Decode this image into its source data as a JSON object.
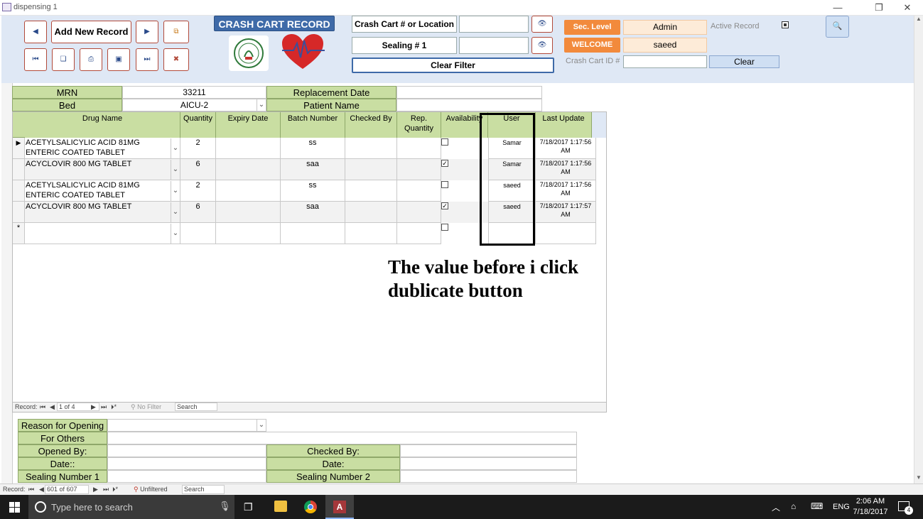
{
  "window": {
    "title": "dispensing 1"
  },
  "header": {
    "add_new_record": "Add New Record",
    "form_title": "CRASH CART RECORD",
    "crash_cart_label": "Crash Cart # or Location",
    "sealing_label": "Sealing  # 1",
    "clear_filter": "Clear Filter",
    "sec_level_label": "Sec. Level",
    "sec_level_value": "Admin",
    "welcome_label": "WELCOME",
    "welcome_value": "saeed",
    "active_record_label": "Active Record",
    "crash_cart_id_label": "Crash Cart ID #",
    "clear_button": "Clear"
  },
  "patient": {
    "mrn_label": "MRN",
    "mrn_value": "33211",
    "bed_label": "Bed",
    "bed_value": "AICU-2",
    "replacement_date_label": "Replacement Date",
    "patient_name_label": "Patient Name"
  },
  "grid": {
    "columns": [
      "Drug Name",
      "Quantity",
      "Expiry Date",
      "Batch Number",
      "Checked By",
      "Rep. Quantity",
      "Availability",
      "User",
      "Last Update"
    ],
    "rows": [
      {
        "drug": "ACETYLSALICYLIC ACID 81MG ENTERIC COATED TABLET",
        "qty": "2",
        "expiry": "",
        "batch": "ss",
        "checked_by": "",
        "rep_qty": "",
        "available": false,
        "user": "Samar",
        "last_update": "7/18/2017 1:17:56 AM"
      },
      {
        "drug": "ACYCLOVIR 800 MG TABLET",
        "qty": "6",
        "expiry": "",
        "batch": "saa",
        "checked_by": "",
        "rep_qty": "",
        "available": true,
        "user": "Samar",
        "last_update": "7/18/2017 1:17:56 AM"
      },
      {
        "drug": "ACETYLSALICYLIC ACID 81MG ENTERIC COATED TABLET",
        "qty": "2",
        "expiry": "",
        "batch": "ss",
        "checked_by": "",
        "rep_qty": "",
        "available": false,
        "user": "saeed",
        "last_update": "7/18/2017 1:17:56 AM"
      },
      {
        "drug": "ACYCLOVIR 800 MG TABLET",
        "qty": "6",
        "expiry": "",
        "batch": "saa",
        "checked_by": "",
        "rep_qty": "",
        "available": true,
        "user": "saeed",
        "last_update": "7/18/2017 1:17:57 AM"
      }
    ],
    "new_row_marker": "*",
    "current_row_marker": "▶"
  },
  "annotation": {
    "line1": "The value before i click",
    "line2": "dublicate button"
  },
  "subform_nav": {
    "label": "Record:",
    "position": "1 of 4",
    "filter": "No Filter",
    "search": "Search"
  },
  "lower": {
    "reason_label": "Reason for Opening",
    "for_others_label": "For Others",
    "opened_by_label": "Opened By:",
    "checked_by_label": "Checked By:",
    "date1_label": "Date::",
    "date2_label": "Date:",
    "sealing1_label": "Sealing Number 1",
    "sealing2_label": "Sealing Number 2"
  },
  "main_nav": {
    "label": "Record:",
    "position": "601 of 607",
    "filter": "Unfiltered",
    "search": "Search"
  },
  "taskbar": {
    "search_placeholder": "Type here to search",
    "lang": "ENG",
    "time": "2:06 AM",
    "date": "7/18/2017",
    "notifications": "4"
  },
  "colors": {
    "accent_green": "#c9dea2",
    "accent_orange": "#f28a3c",
    "header_bg": "#dfe8f5",
    "title_blue": "#3e6aa8"
  }
}
